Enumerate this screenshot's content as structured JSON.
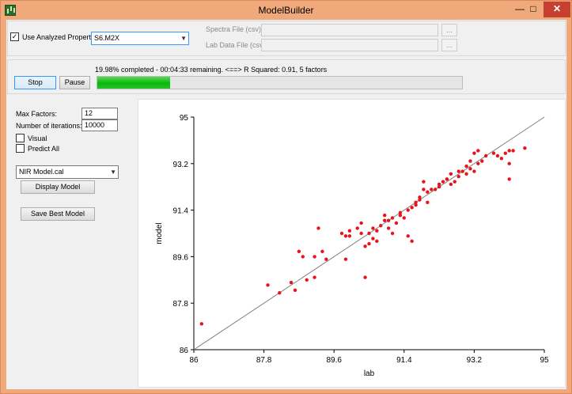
{
  "window": {
    "title": "ModelBuilder",
    "minimize_glyph": "—",
    "maximize_glyph": "□",
    "close_glyph": "✕",
    "icon": "chart-app-icon"
  },
  "top": {
    "use_analyzed_label": "Use Analyzed Property",
    "use_analyzed_checked": true,
    "checkmark": "✓",
    "property_value": "S6.M2X",
    "dropdown_arrow": "▼",
    "spectra_label": "Spectra File (csv):",
    "spectra_value": "",
    "spectra_browse": "...",
    "lab_label": "Lab Data File (csv):",
    "lab_value": "",
    "lab_browse": "..."
  },
  "progress": {
    "status_text": "19.98% completed - 00:04:33 remaining. <==> R Squared: 0.91, 5 factors",
    "fraction": 0.1998,
    "stop_label": "Stop",
    "pause_label": "Pause"
  },
  "left": {
    "max_factors_label": "Max Factors:",
    "max_factors_value": "12",
    "iterations_label": "Number of iterations:",
    "iterations_value": "10000",
    "visual_label": "Visual",
    "visual_checked": false,
    "predict_all_label": "Predict All",
    "predict_all_checked": false,
    "model_file_value": "NIR Model.cal",
    "display_model_label": "Display Model",
    "save_best_label": "Save Best Model"
  },
  "chart_data": {
    "type": "scatter",
    "title": "",
    "xlabel": "lab",
    "ylabel": "model",
    "xlim": [
      86,
      95
    ],
    "ylim": [
      86,
      95
    ],
    "xticks": [
      "86",
      "87.8",
      "89.6",
      "91.4",
      "93.2",
      "95"
    ],
    "yticks": [
      "86",
      "87.8",
      "89.6",
      "91.4",
      "93.2",
      "95"
    ],
    "grid": false,
    "point_color": "#e8141c",
    "reference_line": {
      "x": [
        86,
        95
      ],
      "y": [
        86,
        95
      ],
      "color": "#808080"
    },
    "points": [
      [
        86.2,
        87.0
      ],
      [
        87.9,
        88.5
      ],
      [
        88.2,
        88.2
      ],
      [
        88.5,
        88.6
      ],
      [
        88.6,
        88.3
      ],
      [
        88.7,
        89.8
      ],
      [
        88.8,
        89.6
      ],
      [
        88.9,
        88.7
      ],
      [
        89.1,
        88.8
      ],
      [
        89.1,
        89.6
      ],
      [
        89.2,
        90.7
      ],
      [
        89.3,
        89.8
      ],
      [
        89.4,
        89.5
      ],
      [
        89.8,
        90.5
      ],
      [
        89.9,
        90.4
      ],
      [
        89.9,
        89.5
      ],
      [
        90.0,
        90.4
      ],
      [
        90.0,
        90.6
      ],
      [
        90.2,
        90.7
      ],
      [
        90.3,
        90.5
      ],
      [
        90.3,
        90.9
      ],
      [
        90.4,
        90.0
      ],
      [
        90.4,
        88.8
      ],
      [
        90.5,
        90.1
      ],
      [
        90.5,
        90.5
      ],
      [
        90.6,
        90.3
      ],
      [
        90.6,
        90.7
      ],
      [
        90.7,
        90.6
      ],
      [
        90.7,
        90.2
      ],
      [
        90.8,
        90.8
      ],
      [
        90.9,
        91.0
      ],
      [
        90.9,
        91.2
      ],
      [
        91.0,
        90.7
      ],
      [
        91.0,
        91.0
      ],
      [
        91.1,
        91.1
      ],
      [
        91.1,
        90.5
      ],
      [
        91.2,
        90.9
      ],
      [
        91.3,
        91.2
      ],
      [
        91.3,
        91.3
      ],
      [
        91.4,
        91.1
      ],
      [
        91.5,
        91.4
      ],
      [
        91.5,
        90.4
      ],
      [
        91.6,
        90.2
      ],
      [
        91.6,
        91.5
      ],
      [
        91.7,
        91.7
      ],
      [
        91.7,
        91.6
      ],
      [
        91.8,
        91.8
      ],
      [
        91.8,
        91.9
      ],
      [
        91.9,
        92.2
      ],
      [
        91.9,
        92.5
      ],
      [
        92.0,
        92.1
      ],
      [
        92.0,
        91.7
      ],
      [
        92.1,
        92.2
      ],
      [
        92.2,
        92.2
      ],
      [
        92.3,
        92.4
      ],
      [
        92.3,
        92.3
      ],
      [
        92.4,
        92.5
      ],
      [
        92.5,
        92.6
      ],
      [
        92.6,
        92.4
      ],
      [
        92.6,
        92.8
      ],
      [
        92.7,
        92.5
      ],
      [
        92.8,
        92.9
      ],
      [
        92.8,
        92.7
      ],
      [
        92.9,
        92.9
      ],
      [
        93.0,
        92.8
      ],
      [
        93.0,
        93.1
      ],
      [
        93.1,
        93.3
      ],
      [
        93.1,
        93.0
      ],
      [
        93.2,
        93.6
      ],
      [
        93.2,
        92.9
      ],
      [
        93.3,
        93.7
      ],
      [
        93.4,
        93.3
      ],
      [
        93.5,
        93.5
      ],
      [
        93.7,
        93.6
      ],
      [
        93.8,
        93.5
      ],
      [
        93.9,
        93.4
      ],
      [
        94.0,
        93.6
      ],
      [
        94.1,
        93.7
      ],
      [
        94.1,
        93.2
      ],
      [
        94.1,
        92.6
      ],
      [
        94.2,
        93.7
      ],
      [
        94.5,
        93.8
      ],
      [
        93.3,
        93.2
      ],
      [
        92.5,
        92.6
      ]
    ]
  }
}
